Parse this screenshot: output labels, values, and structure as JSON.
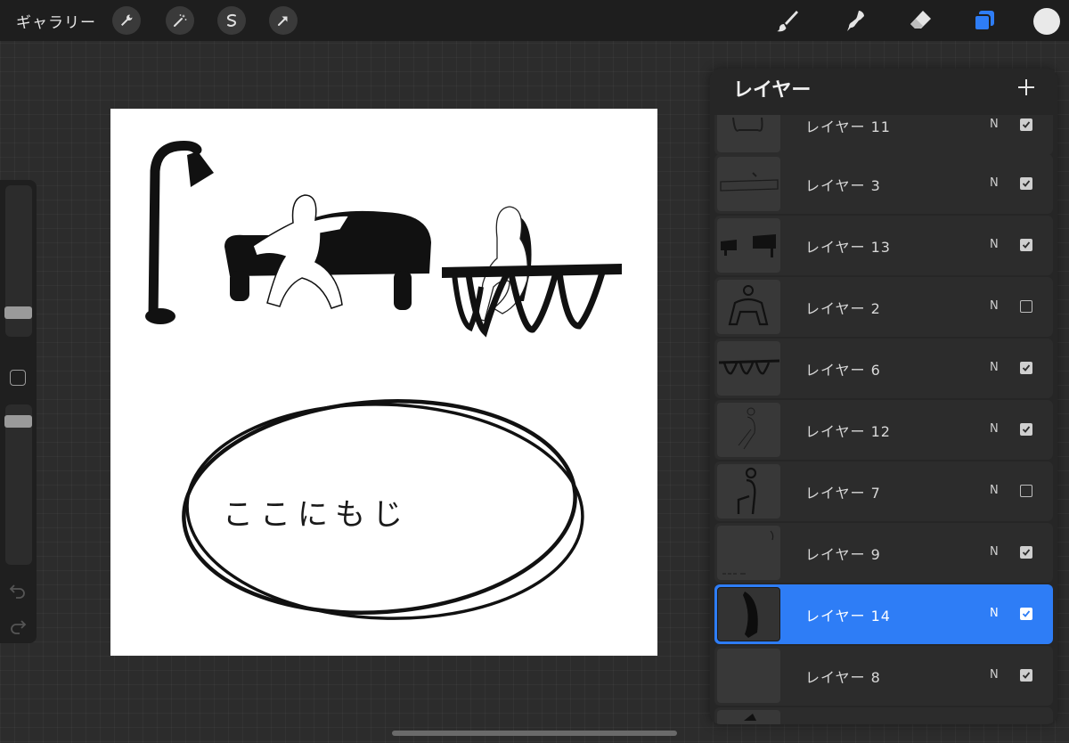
{
  "topbar": {
    "gallery_label": "ギャラリー",
    "left_tools": [
      "wrench-icon",
      "magic-wand-icon",
      "selection-icon",
      "transform-arrow-icon"
    ],
    "right_tools": [
      "brush-icon",
      "smudge-icon",
      "eraser-icon",
      "layers-icon"
    ],
    "active_tool": "layers-icon",
    "accent_color": "#2e7df6",
    "current_color": "#e9e9e9"
  },
  "canvas": {
    "handwritten_text": "ここにもじ"
  },
  "layers_panel": {
    "title": "レイヤー",
    "add_icon": "plus-icon",
    "layers": [
      {
        "name": "レイヤー 11",
        "blend": "N",
        "visible": true,
        "active": false,
        "partial": true
      },
      {
        "name": "レイヤー 3",
        "blend": "N",
        "visible": true,
        "active": false
      },
      {
        "name": "レイヤー 13",
        "blend": "N",
        "visible": true,
        "active": false
      },
      {
        "name": "レイヤー 2",
        "blend": "N",
        "visible": false,
        "active": false
      },
      {
        "name": "レイヤー 6",
        "blend": "N",
        "visible": true,
        "active": false
      },
      {
        "name": "レイヤー 12",
        "blend": "N",
        "visible": true,
        "active": false
      },
      {
        "name": "レイヤー 7",
        "blend": "N",
        "visible": false,
        "active": false
      },
      {
        "name": "レイヤー 9",
        "blend": "N",
        "visible": true,
        "active": false
      },
      {
        "name": "レイヤー 14",
        "blend": "N",
        "visible": true,
        "active": true
      },
      {
        "name": "レイヤー 8",
        "blend": "N",
        "visible": true,
        "active": false
      }
    ]
  }
}
